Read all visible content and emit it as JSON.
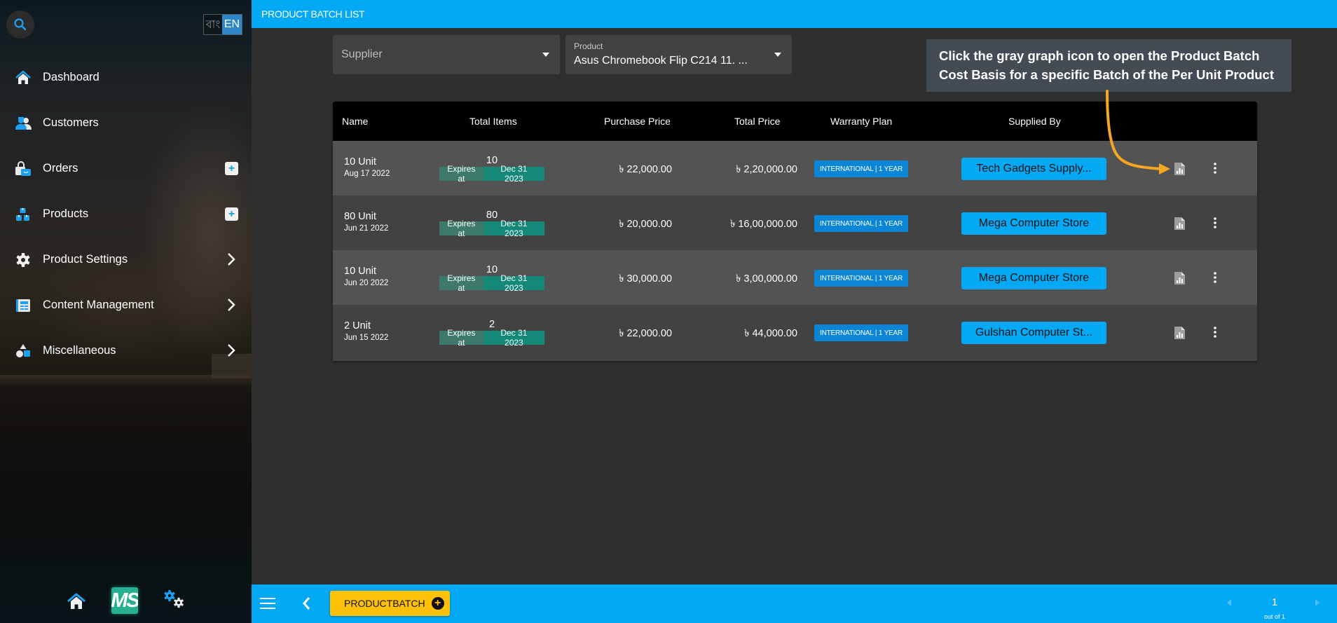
{
  "sidebar": {
    "language": {
      "bn": "বাং",
      "en": "EN",
      "active": "EN"
    },
    "items": [
      {
        "label": "Dashboard",
        "icon": "home-icon",
        "action": null
      },
      {
        "label": "Customers",
        "icon": "customers-icon",
        "action": null
      },
      {
        "label": "Orders",
        "icon": "orders-icon",
        "action": "add"
      },
      {
        "label": "Products",
        "icon": "products-icon",
        "action": "add"
      },
      {
        "label": "Product Settings",
        "icon": "gear-icon",
        "action": "expand"
      },
      {
        "label": "Content Management",
        "icon": "content-icon",
        "action": "expand"
      },
      {
        "label": "Miscellaneous",
        "icon": "shapes-icon",
        "action": "expand"
      }
    ],
    "bottom": {
      "logo_text": "MS"
    }
  },
  "header": {
    "title": "PRODUCT BATCH LIST"
  },
  "filters": {
    "supplier": {
      "placeholder": "Supplier"
    },
    "product": {
      "label": "Product",
      "value": "Asus Chromebook Flip C214 11. ..."
    }
  },
  "callout": {
    "text": "Click the gray graph icon to open the Product Batch Cost Basis for a specific Batch of the Per Unit Product",
    "accent_color": "#f5a623"
  },
  "table": {
    "columns": [
      "Name",
      "Total Items",
      "Purchase Price",
      "Total Price",
      "Warranty Plan",
      "Supplied By"
    ],
    "currency_symbol": "৳",
    "expires_label": "Expires at",
    "rows": [
      {
        "name": "10 Unit",
        "date": "Aug 17 2022",
        "total_items": "10",
        "expires": "Dec 31 2023",
        "purchase_price": "22,000.00",
        "total_price": "2,20,000.00",
        "warranty": "INTERNATIONAL | 1 YEAR",
        "supplier": "Tech Gadgets Supply..."
      },
      {
        "name": "80 Unit",
        "date": "Jun 21 2022",
        "total_items": "80",
        "expires": "Dec 31 2023",
        "purchase_price": "20,000.00",
        "total_price": "16,00,000.00",
        "warranty": "INTERNATIONAL | 1 YEAR",
        "supplier": "Mega Computer Store"
      },
      {
        "name": "10 Unit",
        "date": "Jun 20 2022",
        "total_items": "10",
        "expires": "Dec 31 2023",
        "purchase_price": "30,000.00",
        "total_price": "3,00,000.00",
        "warranty": "INTERNATIONAL | 1 YEAR",
        "supplier": "Mega Computer Store"
      },
      {
        "name": "2 Unit",
        "date": "Jun 15 2022",
        "total_items": "2",
        "expires": "Dec 31 2023",
        "purchase_price": "22,000.00",
        "total_price": "44,000.00",
        "warranty": "INTERNATIONAL | 1 YEAR",
        "supplier": "Gulshan Computer St..."
      }
    ]
  },
  "footer": {
    "action_button": "PRODUCTBATCH",
    "pagination": {
      "current": "1",
      "total_label": "out of 1"
    }
  },
  "colors": {
    "primary": "#03a9f4",
    "warning": "#ffc107",
    "expiry_teal": "#14897a",
    "warranty_blue": "#0b85d6"
  }
}
